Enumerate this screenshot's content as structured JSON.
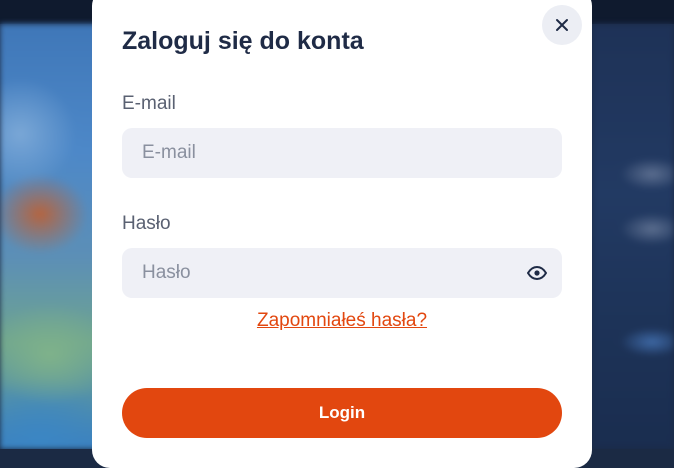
{
  "modal": {
    "title": "Zaloguj się do konta",
    "close_icon": "close-icon",
    "email": {
      "label": "E-mail",
      "placeholder": "E-mail",
      "value": ""
    },
    "password": {
      "label": "Hasło",
      "placeholder": "Hasło",
      "value": "",
      "toggle_icon": "eye-icon"
    },
    "forgot_link": "Zapomniałeś hasła?",
    "login_button": "Login"
  },
  "colors": {
    "accent": "#e2470f",
    "title": "#1f2b46",
    "input_bg": "#eff0f6",
    "modal_bg": "#ffffff"
  }
}
